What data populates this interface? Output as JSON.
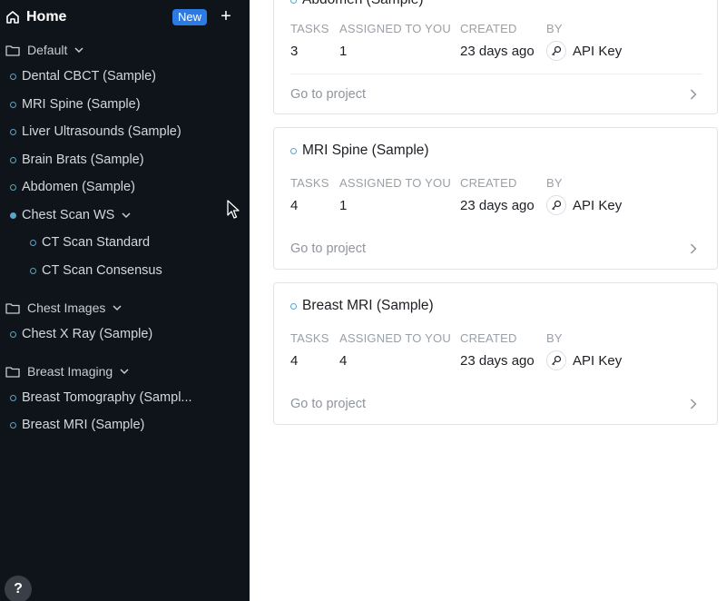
{
  "sidebar": {
    "home_label": "Home",
    "new_label": "New",
    "plus_label": "+",
    "help_label": "?",
    "groups": [
      {
        "label": "Default",
        "items": [
          {
            "label": "Dental CBCT (Sample)"
          },
          {
            "label": "MRI Spine (Sample)"
          },
          {
            "label": "Liver Ultrasounds (Sample)"
          },
          {
            "label": "Brain Brats (Sample)"
          },
          {
            "label": "Abdomen (Sample)"
          },
          {
            "label": "Chest Scan WS",
            "children": [
              "CT Scan Standard",
              "CT Scan Consensus"
            ]
          }
        ]
      },
      {
        "label": "Chest Images",
        "items": [
          {
            "label": "Chest X Ray (Sample)"
          }
        ]
      },
      {
        "label": "Breast Imaging",
        "items": [
          {
            "label": "Breast Tomography (Sampl..."
          },
          {
            "label": "Breast MRI (Sample)"
          }
        ]
      }
    ]
  },
  "columns": {
    "tasks": "TASKS",
    "assigned": "ASSIGNED TO YOU",
    "created": "CREATED",
    "by": "BY"
  },
  "goto_label": "Go to project",
  "projects": [
    {
      "title": "Abdomen (Sample)",
      "tasks": "3",
      "assigned": "1",
      "created": "23 days ago",
      "by": "API Key"
    },
    {
      "title": "MRI Spine (Sample)",
      "tasks": "4",
      "assigned": "1",
      "created": "23 days ago",
      "by": "API Key"
    },
    {
      "title": "Breast MRI (Sample)",
      "tasks": "4",
      "assigned": "4",
      "created": "23 days ago",
      "by": "API Key"
    }
  ],
  "colors": {
    "sidebar_bg": "#0f131a",
    "accent": "#2c7be5",
    "dot": "#5aa6c9"
  }
}
